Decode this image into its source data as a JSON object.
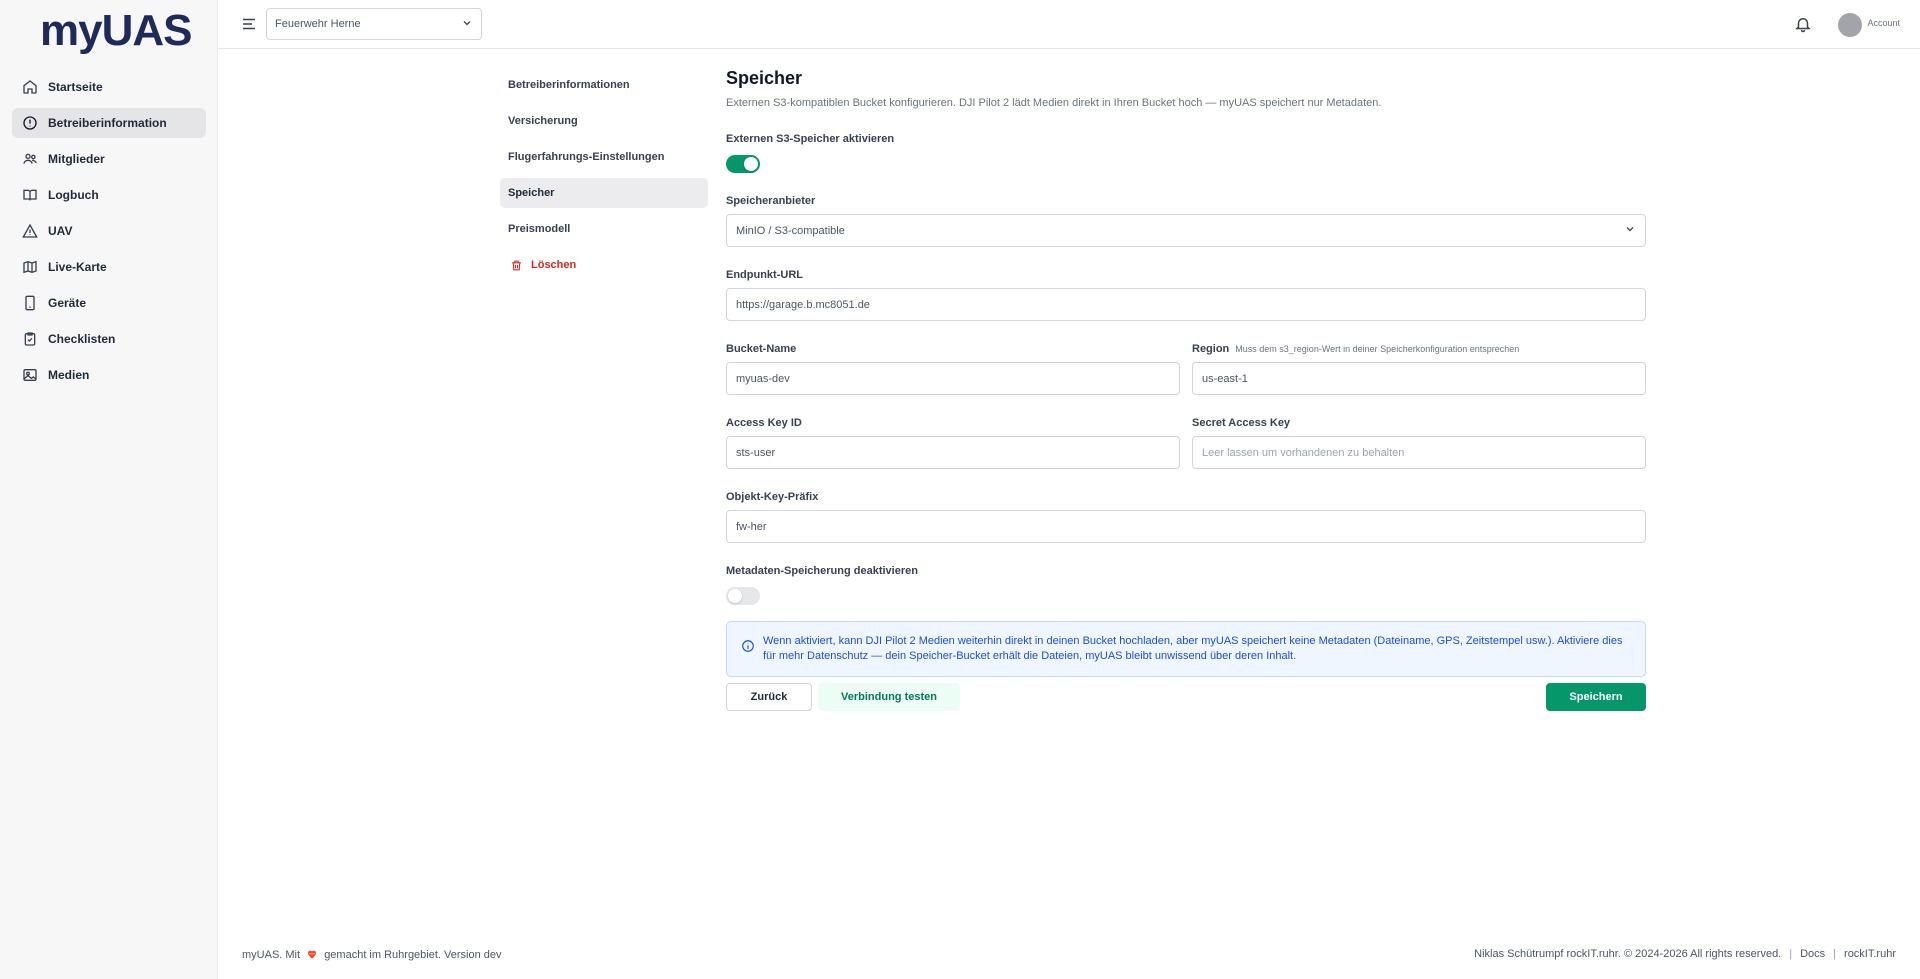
{
  "app": {
    "logo_text": "myUAS"
  },
  "sidebar": {
    "items": [
      {
        "label": "Startseite",
        "icon": "home-icon"
      },
      {
        "label": "Betreiberinformation",
        "icon": "alert-circle-icon",
        "active": true
      },
      {
        "label": "Mitglieder",
        "icon": "users-icon"
      },
      {
        "label": "Logbuch",
        "icon": "book-icon"
      },
      {
        "label": "UAV",
        "icon": "triangle-icon"
      },
      {
        "label": "Live-Karte",
        "icon": "map-icon"
      },
      {
        "label": "Geräte",
        "icon": "device-icon"
      },
      {
        "label": "Checklisten",
        "icon": "clipboard-icon"
      },
      {
        "label": "Medien",
        "icon": "image-icon"
      }
    ]
  },
  "header": {
    "org_value": "Feuerwehr Herne",
    "account_label": "Account"
  },
  "subnav": {
    "items": [
      {
        "label": "Betreiberinformationen"
      },
      {
        "label": "Versicherung"
      },
      {
        "label": "Flugerfahrungs-Einstellungen"
      },
      {
        "label": "Speicher",
        "active": true
      },
      {
        "label": "Preismodell"
      }
    ],
    "delete_label": "Löschen"
  },
  "main": {
    "title": "Speicher",
    "description": "Externen S3-kompatiblen Bucket konfigurieren. DJI Pilot 2 lädt Medien direkt in Ihren Bucket hoch — myUAS speichert nur Metadaten.",
    "enable_label": "Externen S3-Speicher aktivieren",
    "enable_on": true,
    "provider_label": "Speicheranbieter",
    "provider_value": "MinIO / S3-compatible",
    "endpoint_label": "Endpunkt-URL",
    "endpoint_value": "https://garage.b.mc8051.de",
    "bucket_label": "Bucket-Name",
    "bucket_value": "myuas-dev",
    "region_label": "Region",
    "region_hint": "Muss dem s3_region-Wert in deiner Speicherkonfiguration entsprechen",
    "region_value": "us-east-1",
    "access_key_label": "Access Key ID",
    "access_key_value": "sts-user",
    "secret_label": "Secret Access Key",
    "secret_placeholder": "Leer lassen um vorhandenen zu behalten",
    "prefix_label": "Objekt-Key-Präfix",
    "prefix_value": "fw-her",
    "metadata_label": "Metadaten-Speicherung deaktivieren",
    "metadata_on": false,
    "info_text": "Wenn aktiviert, kann DJI Pilot 2 Medien weiterhin direkt in deinen Bucket hochladen, aber myUAS speichert keine Metadaten (Dateiname, GPS, Zeitstempel usw.). Aktiviere dies für mehr Datenschutz — dein Speicher-Bucket erhält die Dateien, myUAS bleibt unwissend über deren Inhalt.",
    "back_label": "Zurück",
    "test_label": "Verbindung testen",
    "save_label": "Speichern"
  },
  "footer": {
    "left_prefix": "myUAS. Mit",
    "left_suffix": "gemacht im Ruhrgebiet. Version dev",
    "copyright": "Niklas Schütrumpf rockIT.ruhr. © 2024-2026 All rights reserved.",
    "docs": "Docs",
    "rockit": "rockIT.ruhr"
  },
  "colors": {
    "accent": "#059669",
    "danger": "#dc2626",
    "info": "#1d4ed8"
  }
}
